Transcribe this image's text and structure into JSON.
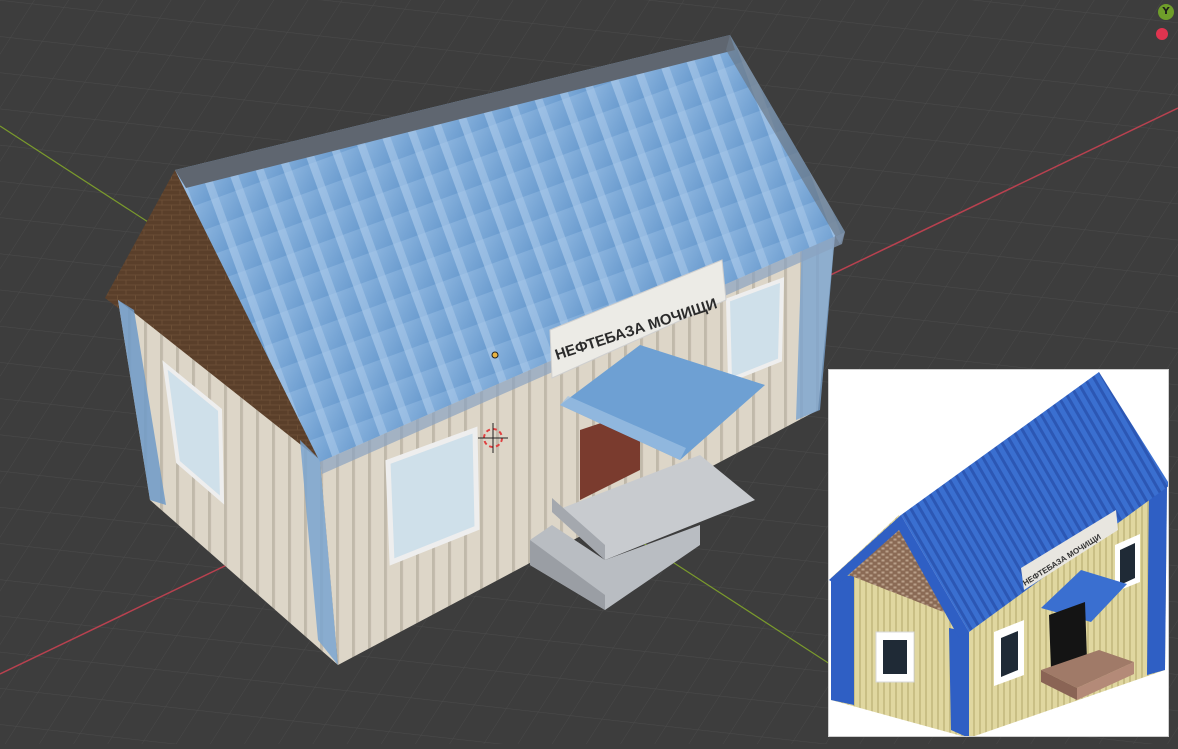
{
  "viewport": {
    "axis_gizmo": {
      "y_label": "Y"
    },
    "model": {
      "sign_text": "НЕФТЕБАЗА МОЧИЩИ"
    }
  },
  "reference_image": {
    "sign_text": "НЕФТЕБАЗА МОЧИЩИ"
  },
  "colors": {
    "grid_background": "#3d3d3d",
    "x_axis": "#b8414f",
    "y_axis": "#7a9a2c",
    "roof_model": "#7aa7d6",
    "roof_reference": "#3a6fd0",
    "wall_model": "#d9d2c4",
    "wall_reference": "#e0d7a0",
    "door": "#7a3b2e"
  }
}
